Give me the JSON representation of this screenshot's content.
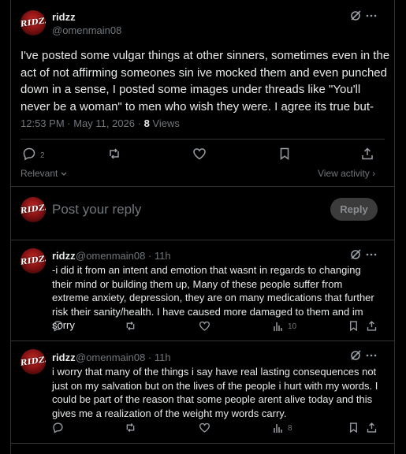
{
  "post": {
    "author_name": "ridzz",
    "author_handle": "@omenmain08",
    "avatar_text": "RIDZZ",
    "body": "I've posted some vulgar things at other sinners, sometimes even in the act of not affirming someones sin ive mocked them and even punched down in a sense, I posted some images under threads like \"You'll never be a woman\" to men who wish they were. I agree its true but-",
    "timestamp": "12:53 PM · May 11, 2026 · ",
    "views_count": "8",
    "views_label": " Views",
    "reply_count": "2",
    "relevant_label": "Relevant",
    "view_activity_label": "View activity ›"
  },
  "composer": {
    "placeholder": "Post your reply",
    "reply_button": "Reply"
  },
  "replies": [
    {
      "author_name": "ridzz",
      "author_handle": "@omenmain08 · 11h",
      "body": "-i did it from an intent and emotion that wasnt in regards to changing their mind or building them up, Many of these people suffer from extreme anxiety, depression, they are on many medications that further risk their sanity/health. I have caused more damaged to them and im sorry",
      "views": "10"
    },
    {
      "author_name": "ridzz",
      "author_handle": "@omenmain08 · 11h",
      "body": "i worry that many of the things i say have real lasting consequences not just on my salvation but on the lives of the people i hurt with my words. I could be part of the reason that some people arent alive today and this gives me a realization of the weight my words carry.",
      "views": "8"
    }
  ],
  "colors": {
    "background": "#000000",
    "text": "#e7e9ea",
    "muted": "#71767b",
    "border": "#2f3336"
  },
  "icons": [
    "grok-icon",
    "more-icon",
    "reply-icon",
    "repost-icon",
    "like-icon",
    "bookmark-icon",
    "share-icon",
    "views-icon"
  ]
}
